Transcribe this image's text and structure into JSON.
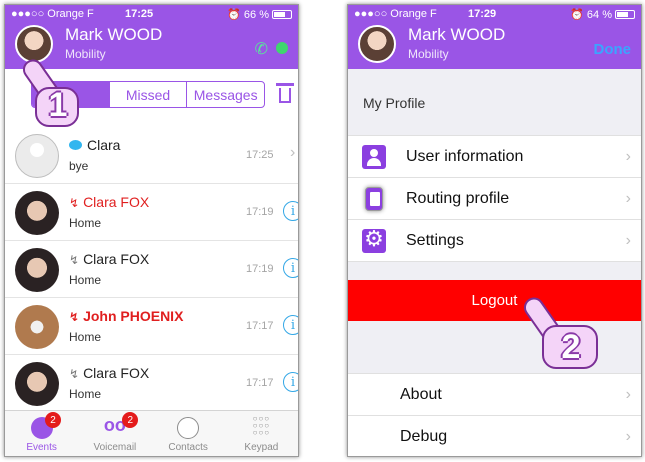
{
  "left": {
    "status": {
      "carrier": "●●●○○ Orange F",
      "time": "17:25",
      "battery": "66 %"
    },
    "header": {
      "name": "Mark WOOD",
      "sub": "Mobility"
    },
    "tabs": [
      "Missed",
      "Messages"
    ],
    "calls": [
      {
        "name": "Clara",
        "sub": "bye",
        "time": "17:25",
        "type": "message"
      },
      {
        "name": "Clara FOX",
        "sub": "Home",
        "time": "17:19",
        "type": "missed"
      },
      {
        "name": "Clara FOX",
        "sub": "Home",
        "time": "17:19",
        "type": "incoming"
      },
      {
        "name": "John PHOENIX",
        "sub": "Home",
        "time": "17:17",
        "type": "missed-bold"
      },
      {
        "name": "Clara FOX",
        "sub": "Home",
        "time": "17:17",
        "type": "incoming"
      }
    ],
    "tabbar": [
      {
        "label": "Events",
        "badge": "2"
      },
      {
        "label": "Voicemail",
        "badge": "2"
      },
      {
        "label": "Contacts"
      },
      {
        "label": "Keypad"
      }
    ],
    "step": "1"
  },
  "right": {
    "status": {
      "carrier": "●●●○○ Orange F",
      "time": "17:29",
      "battery": "64 %"
    },
    "header": {
      "name": "Mark WOOD",
      "sub": "Mobility",
      "done": "Done"
    },
    "section_title": "My Profile",
    "menu": [
      "User information",
      "Routing profile",
      "Settings"
    ],
    "logout": "Logout",
    "bottom_menu": [
      "About",
      "Debug"
    ],
    "step": "2"
  },
  "colors": {
    "accent": "#9a55e6",
    "missed": "#e01f1f",
    "logout": "#ff0000",
    "info": "#33a7e6"
  }
}
